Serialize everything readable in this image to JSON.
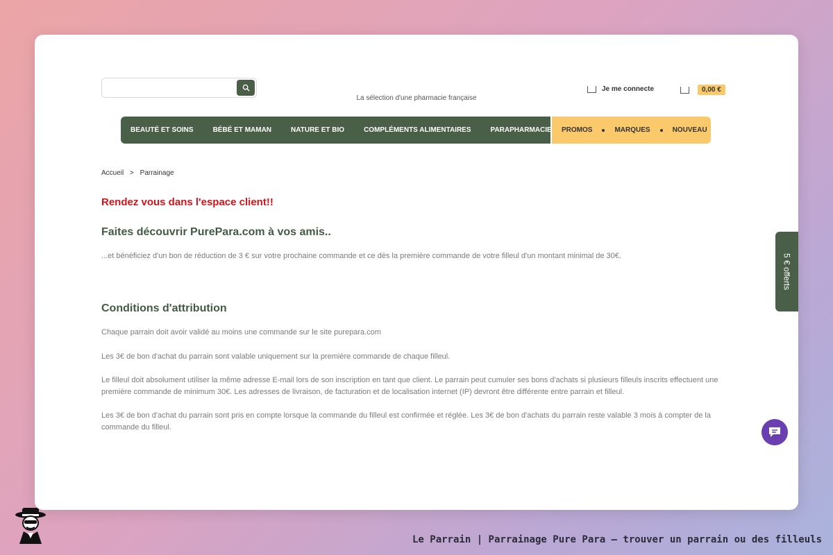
{
  "header": {
    "tagline": "La sélection d'une pharmacie française",
    "account_label": "Je me connecte",
    "cart_total": "0,00 €"
  },
  "nav": {
    "main_items": [
      "BEAUTÉ ET SOINS",
      "BÉBÉ ET MAMAN",
      "NATURE ET BIO",
      "COMPLÉMENTS ALIMENTAIRES",
      "PARAPHARMACIE"
    ],
    "promo_items": [
      "PROMOS",
      "MARQUES",
      "NOUVEAU"
    ]
  },
  "breadcrumb": {
    "home": "Accueil",
    "separator": ">",
    "current": "Parrainage"
  },
  "content": {
    "red_title": "Rendez vous dans l'espace client!!",
    "heading1": "Faites découvrir PurePara.com à vos amis..",
    "intro": "...et bénéficiez d'un bon de réduction de 3 € sur votre prochaine commande et ce dès la première commande de votre filleul d'un montant minimal de 30€.",
    "heading2": "Conditions d'attribution",
    "p1": "Chaque parrain doit avoir validé au moins une commande sur le site purepara.com",
    "p2": "Les 3€ de bon d'achat du parrain sont valable uniquement sur la première commande de chaque filleul.",
    "p3": "Le filleul doit absolument utiliser la même adresse E-mail lors de son inscription en tant que client. Le parrain peut cumuler ses bons d'achats si plusieurs filleuls inscrits effectuent une première commande de minimum 30€. Les adresses de livraison, de facturation et de localisation internet (IP) devront être différente entre parrain et filleul.",
    "p4": "Les 3€ de bon d'achat du parrain sont pris en compte lorsque la commande du filleul est confirmée et réglée. Les 3€ de bon d'achats du parrain reste valable 3 mois à compter de la commande du filleul."
  },
  "side_tab": {
    "label": "5 € offerts"
  },
  "footer": {
    "title": "Le Parrain | Parrainage Pure Para — trouver un parrain ou des filleuls"
  },
  "colors": {
    "brand_green": "#4a5f48",
    "promo_yellow": "#f9c96b",
    "alert_red": "#d0161b",
    "chat_purple": "#6a3fb0"
  }
}
